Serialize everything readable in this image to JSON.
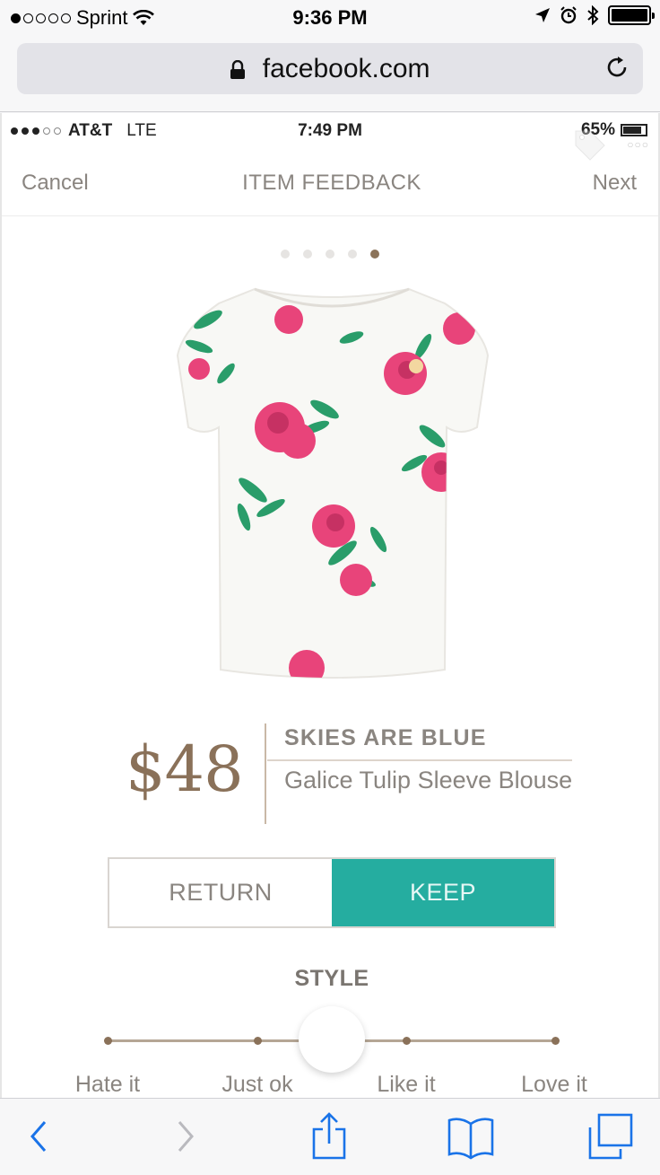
{
  "os_status": {
    "carrier": "Sprint",
    "time": "9:36 PM"
  },
  "browser": {
    "url": "facebook.com"
  },
  "inner_status": {
    "carrier": "AT&T",
    "network": "LTE",
    "time": "7:49 PM",
    "battery": "65%"
  },
  "nav": {
    "cancel": "Cancel",
    "title": "ITEM FEEDBACK",
    "next": "Next"
  },
  "pager": {
    "total": 5,
    "active_index": 4
  },
  "item": {
    "price": "$48",
    "brand": "SKIES ARE BLUE",
    "name": "Galice Tulip Sleeve Blouse"
  },
  "actions": {
    "return": "RETURN",
    "keep": "KEEP",
    "selected": "KEEP"
  },
  "style_rating": {
    "label": "STYLE",
    "options": [
      "Hate it",
      "Just ok",
      "Like it",
      "Love it"
    ],
    "value_fraction": 0.5
  },
  "colors": {
    "accent_keep": "#25ada0",
    "brown_accent": "#8a7159",
    "ios_blue": "#1a73e8"
  }
}
